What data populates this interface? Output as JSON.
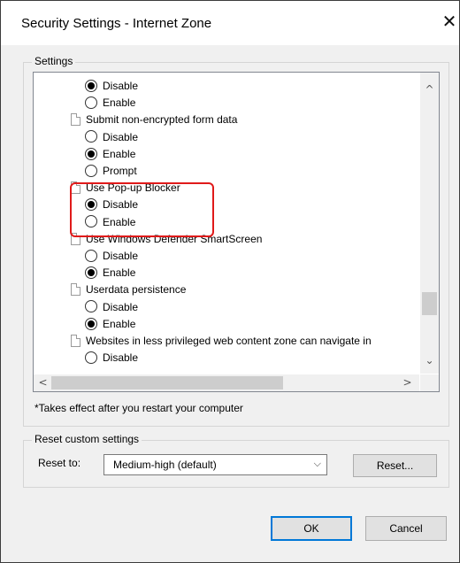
{
  "window": {
    "title": "Security Settings - Internet Zone",
    "close_glyph": "✕"
  },
  "settings_group": {
    "label": "Settings"
  },
  "settings_list": [
    {
      "kind": "radio",
      "label": "Disable",
      "checked": true
    },
    {
      "kind": "radio",
      "label": "Enable",
      "checked": false
    },
    {
      "kind": "category",
      "label": "Submit non-encrypted form data"
    },
    {
      "kind": "radio",
      "label": "Disable",
      "checked": false
    },
    {
      "kind": "radio",
      "label": "Enable",
      "checked": true
    },
    {
      "kind": "radio",
      "label": "Prompt",
      "checked": false
    },
    {
      "kind": "category",
      "label": "Use Pop-up Blocker"
    },
    {
      "kind": "radio",
      "label": "Disable",
      "checked": true
    },
    {
      "kind": "radio",
      "label": "Enable",
      "checked": false
    },
    {
      "kind": "category",
      "label": "Use Windows Defender SmartScreen"
    },
    {
      "kind": "radio",
      "label": "Disable",
      "checked": false
    },
    {
      "kind": "radio",
      "label": "Enable",
      "checked": true
    },
    {
      "kind": "category",
      "label": "Userdata persistence"
    },
    {
      "kind": "radio",
      "label": "Disable",
      "checked": false
    },
    {
      "kind": "radio",
      "label": "Enable",
      "checked": true
    },
    {
      "kind": "category",
      "label": "Websites in less privileged web content zone can navigate in"
    },
    {
      "kind": "radio",
      "label": "Disable",
      "checked": false
    }
  ],
  "scrollbar": {
    "up": "^",
    "down": "⌄",
    "left": "<",
    "right": ">"
  },
  "note": "*Takes effect after you restart your computer",
  "reset_group": {
    "label": "Reset custom settings",
    "reset_to_label": "Reset to:",
    "selected": "Medium-high (default)",
    "dropdown_glyph": "⌵",
    "reset_button": "Reset..."
  },
  "buttons": {
    "ok": "OK",
    "cancel": "Cancel"
  },
  "colors": {
    "highlight_box": "#e01a1a",
    "default_button_border": "#0078d7"
  }
}
